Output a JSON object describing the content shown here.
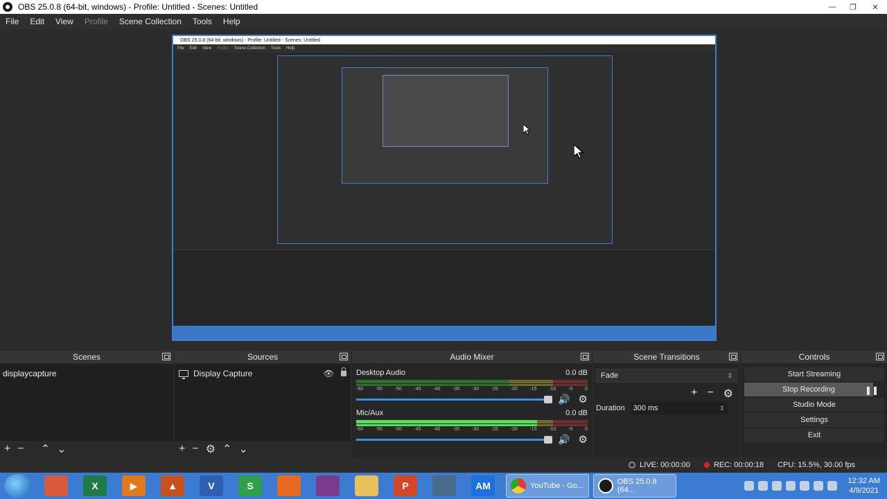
{
  "window": {
    "title": "OBS 25.0.8 (64-bit, windows) - Profile: Untitled - Scenes: Untitled",
    "minimize": "—",
    "maximize": "❐",
    "close": "✕"
  },
  "menu": {
    "items": [
      {
        "label": "File",
        "disabled": false
      },
      {
        "label": "Edit",
        "disabled": false
      },
      {
        "label": "View",
        "disabled": false
      },
      {
        "label": "Profile",
        "disabled": true
      },
      {
        "label": "Scene Collection",
        "disabled": false
      },
      {
        "label": "Tools",
        "disabled": false
      },
      {
        "label": "Help",
        "disabled": false
      }
    ]
  },
  "preview": {
    "nested_title": "OBS 25.0.8 (64-bit, windows) - Profile: Untitled - Scenes: Untitled",
    "nested_menu": [
      "File",
      "Edit",
      "View",
      "Profile",
      "Scene Collection",
      "Tools",
      "Help"
    ]
  },
  "scenes": {
    "header": "Scenes",
    "items": [
      "displaycapture"
    ]
  },
  "sources": {
    "header": "Sources",
    "items": [
      {
        "name": "Display Capture",
        "icon": "monitor-icon"
      }
    ]
  },
  "mixer": {
    "header": "Audio Mixer",
    "ticks": [
      "-60",
      "-55",
      "-50",
      "-45",
      "-40",
      "-35",
      "-30",
      "-25",
      "-20",
      "-15",
      "-10",
      "-5",
      "0"
    ],
    "tracks": [
      {
        "name": "Desktop Audio",
        "level": "0.0 dB",
        "meter": 0.0
      },
      {
        "name": "Mic/Aux",
        "level": "0.0 dB",
        "meter": 0.78
      }
    ]
  },
  "transitions": {
    "header": "Scene Transitions",
    "selected": "Fade",
    "duration_label": "Duration",
    "duration_value": "300 ms"
  },
  "controls": {
    "header": "Controls",
    "start_streaming": "Start Streaming",
    "stop_recording": "Stop Recording",
    "studio_mode": "Studio Mode",
    "settings": "Settings",
    "exit": "Exit"
  },
  "status": {
    "live": "LIVE: 00:00:00",
    "rec": "REC: 00:00:18",
    "cpu": "CPU: 15.5%, 30.00 fps"
  },
  "taskbar": {
    "tasks": [
      "YouTube - Go...",
      "OBS 25.0.8 (64..."
    ],
    "apps": [
      {
        "name": "chrome-icon",
        "label": "",
        "color": "#d65a3b"
      },
      {
        "name": "excel-icon",
        "label": "X",
        "color": "#1e7b45"
      },
      {
        "name": "media-player-icon",
        "label": "▶",
        "color": "#e07a1c"
      },
      {
        "name": "matlab-icon",
        "label": "▲",
        "color": "#c7521e"
      },
      {
        "name": "visio-icon",
        "label": "V",
        "color": "#2f5fb3"
      },
      {
        "name": "sheets-icon",
        "label": "S",
        "color": "#2ea04a"
      },
      {
        "name": "firefox-icon",
        "label": "",
        "color": "#e86a1e"
      },
      {
        "name": "winrar-icon",
        "label": "",
        "color": "#7a3b8c"
      },
      {
        "name": "folder-icon",
        "label": "",
        "color": "#e8c15a"
      },
      {
        "name": "powerpoint-icon",
        "label": "P",
        "color": "#d24726"
      },
      {
        "name": "network-icon",
        "label": "",
        "color": "#4a6b8a"
      },
      {
        "name": "am-icon",
        "label": "AM",
        "color": "#1e6fe0"
      }
    ],
    "clock_time": "12:32 AM",
    "clock_date": "4/9/2021"
  }
}
